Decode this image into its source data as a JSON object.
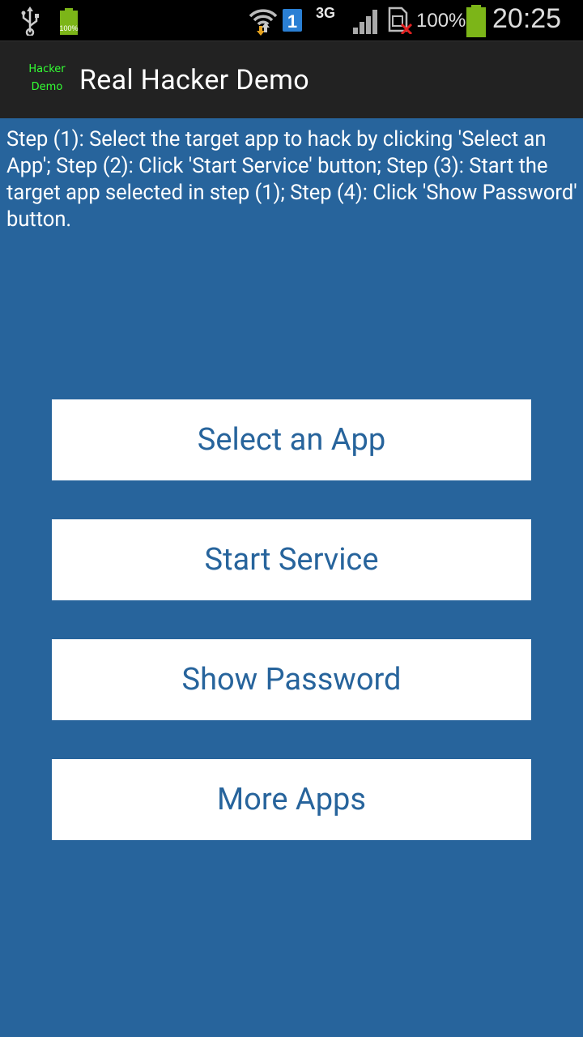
{
  "status_bar": {
    "battery_small_label": "100%",
    "network_type": "3G",
    "battery_percent": "100%",
    "time": "20:25",
    "icons": [
      "usb-icon",
      "battery-small-icon",
      "wifi-icon",
      "sim-1-icon",
      "signal-icon",
      "no-sim-icon",
      "battery-icon"
    ]
  },
  "action_bar": {
    "app_icon_line1": "Hacker",
    "app_icon_line2": "Demo",
    "title": "Real Hacker Demo"
  },
  "instructions": "Step (1): Select the target app to hack by clicking 'Select an App'; Step (2): Click 'Start Service' button; Step (3): Start the target app selected in step (1); Step (4): Click 'Show Password' button.",
  "buttons": {
    "select_app": "Select an App",
    "start_service": "Start Service",
    "show_password": "Show Password",
    "more_apps": "More Apps"
  },
  "colors": {
    "background": "#27649c",
    "status_bar": "#000000",
    "action_bar": "#222222",
    "button_bg": "#ffffff",
    "button_text": "#27649c",
    "battery_green": "#7cb518"
  }
}
